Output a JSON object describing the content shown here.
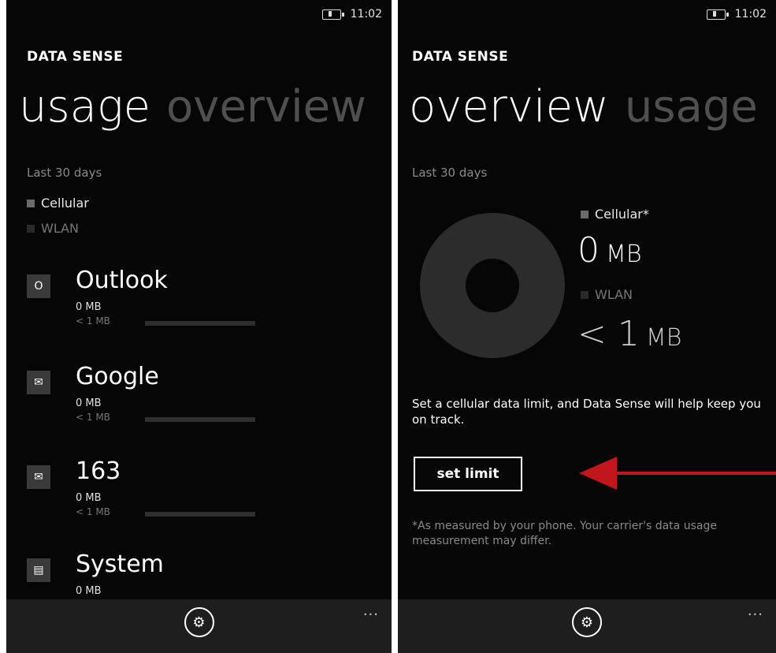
{
  "left": {
    "status_time": "11:02",
    "app_title": "DATA SENSE",
    "pivot_active": "usage",
    "pivot_next": "overview",
    "period": "Last 30 days",
    "legend_cellular": "Cellular",
    "legend_wlan": "WLAN",
    "apps": [
      {
        "icon": "outlook-icon",
        "name": "Outlook",
        "cellular": "0 MB",
        "wlan": "< 1 MB"
      },
      {
        "icon": "mail-icon",
        "name": "Google",
        "cellular": "0 MB",
        "wlan": "< 1 MB"
      },
      {
        "icon": "mail-icon",
        "name": "163",
        "cellular": "0 MB",
        "wlan": "< 1 MB"
      },
      {
        "icon": "system-icon",
        "name": "System",
        "cellular": "0 MB",
        "wlan": ""
      }
    ]
  },
  "right": {
    "status_time": "11:02",
    "app_title": "DATA SENSE",
    "pivot_active": "overview",
    "pivot_next": "usage",
    "period": "Last 30 days",
    "cellular_label": "Cellular*",
    "cellular_value": "0",
    "cellular_unit": "MB",
    "wlan_label": "WLAN",
    "wlan_value": "< 1",
    "wlan_unit": "MB",
    "message": "Set a cellular data limit, and Data Sense will help keep you on track.",
    "set_limit_label": "set limit",
    "footnote": "*As measured by your phone. Your carrier's data usage measurement may differ."
  },
  "appbar": {
    "more_label": "..."
  },
  "colors": {
    "background": "#060606",
    "arrow": "#c0161c",
    "appbar": "#1e1e1e"
  }
}
